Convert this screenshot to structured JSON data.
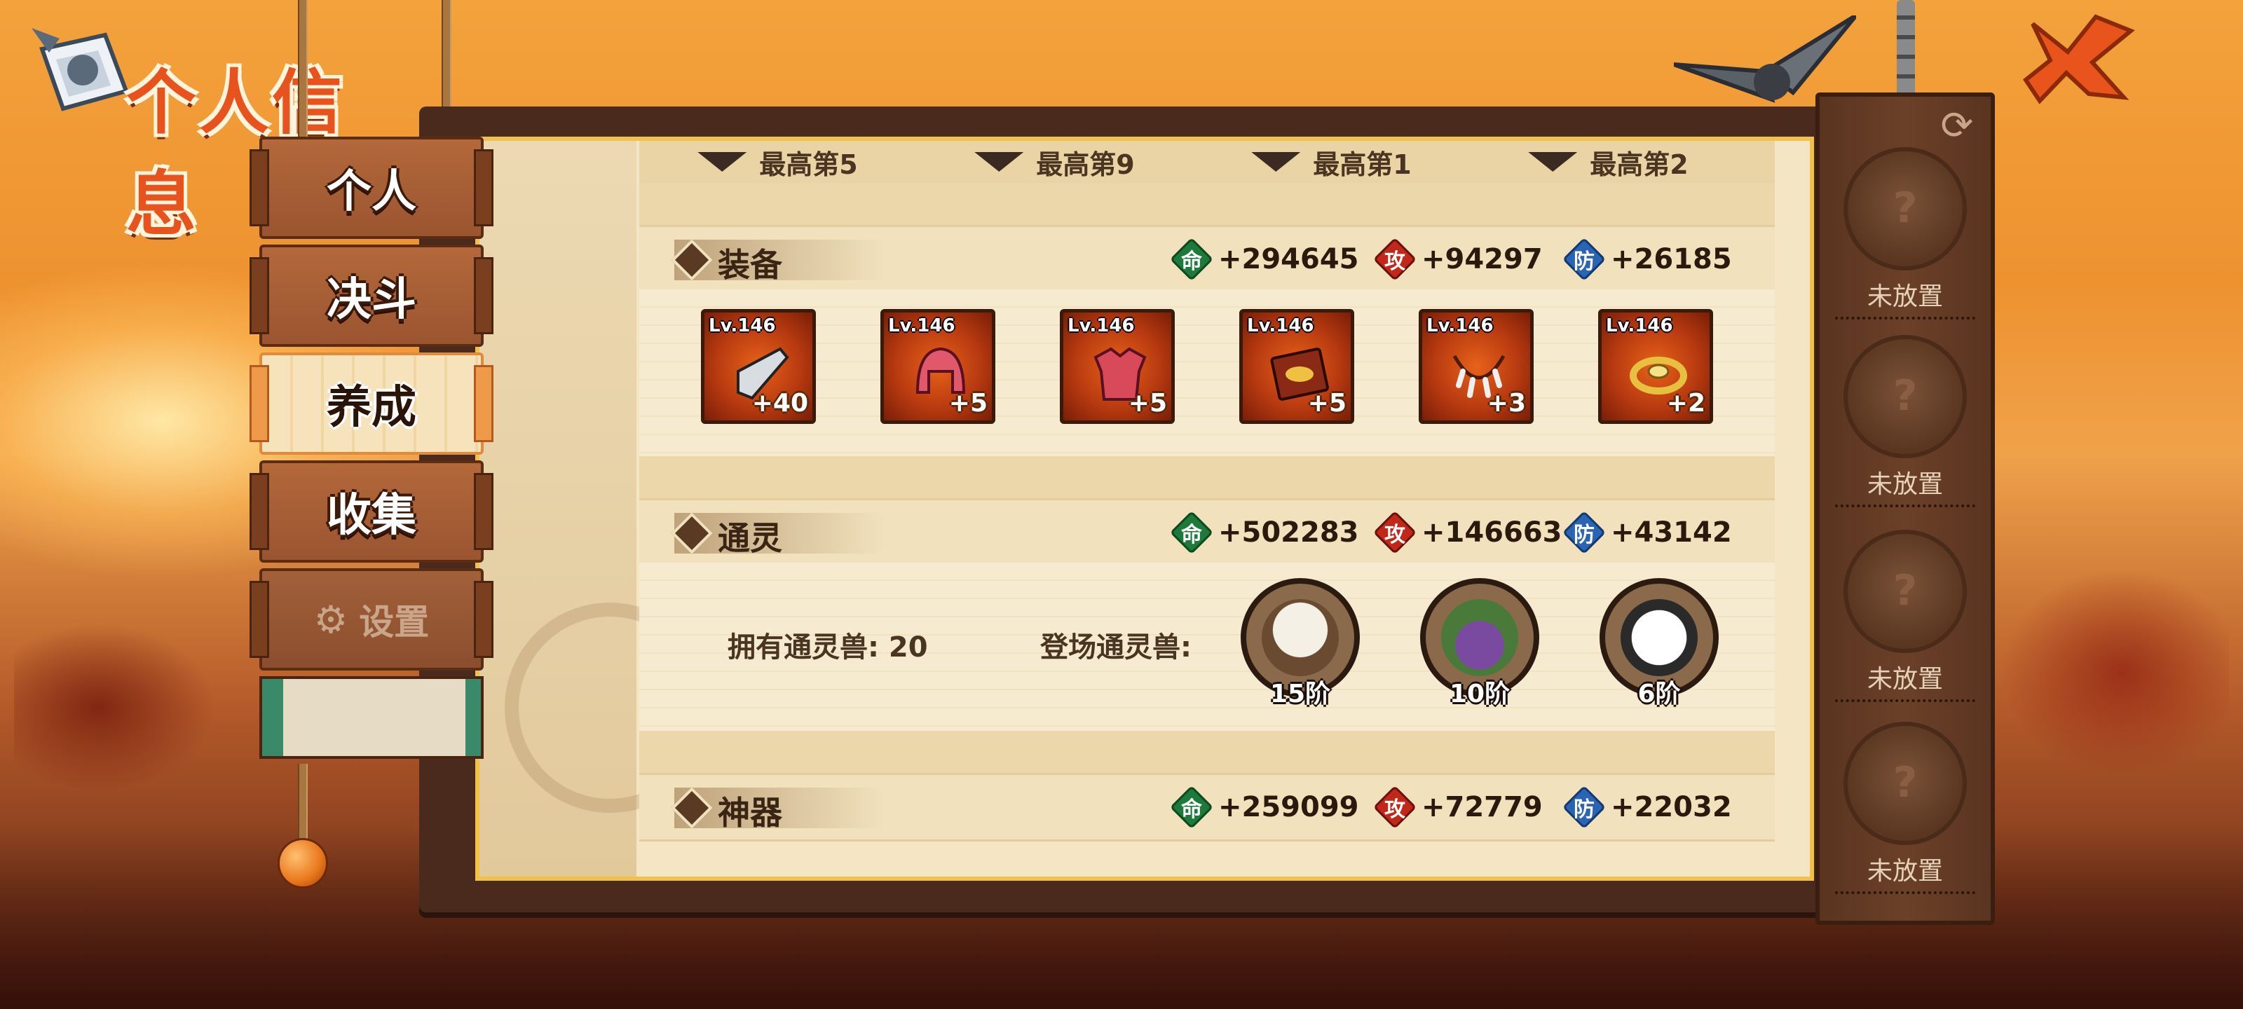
{
  "title": "个人信息",
  "menu": {
    "tabs": [
      {
        "label": "个人",
        "state": "normal"
      },
      {
        "label": "决斗",
        "state": "normal"
      },
      {
        "label": "养成",
        "state": "active"
      },
      {
        "label": "收集",
        "state": "normal"
      },
      {
        "label": "设置",
        "state": "disabled"
      }
    ]
  },
  "ranks": [
    {
      "label": "最高第5"
    },
    {
      "label": "最高第9"
    },
    {
      "label": "最高第1"
    },
    {
      "label": "最高第2"
    }
  ],
  "badges": {
    "hp": "命",
    "atk": "攻",
    "def": "防"
  },
  "sections": {
    "equipment": {
      "title": "装备",
      "hp": "+294645",
      "atk": "+94297",
      "def": "+26185",
      "items": [
        {
          "level": "Lv.146",
          "plus": "+40",
          "icon": "blade-icon"
        },
        {
          "level": "Lv.146",
          "plus": "+5",
          "icon": "helmet-icon"
        },
        {
          "level": "Lv.146",
          "plus": "+5",
          "icon": "armor-icon"
        },
        {
          "level": "Lv.146",
          "plus": "+5",
          "icon": "scroll-book-icon"
        },
        {
          "level": "Lv.146",
          "plus": "+3",
          "icon": "claw-necklace-icon"
        },
        {
          "level": "Lv.146",
          "plus": "+2",
          "icon": "headband-icon"
        }
      ]
    },
    "summon": {
      "title": "通灵",
      "hp": "+502283",
      "atk": "+146663",
      "def": "+43142",
      "owned_label": "拥有通灵兽: 20",
      "active_label": "登场通灵兽:",
      "beasts": [
        {
          "rank": "15阶",
          "icon": "monkey-summon-icon"
        },
        {
          "rank": "10阶",
          "icon": "toad-summon-icon"
        },
        {
          "rank": "6阶",
          "icon": "panda-summon-icon"
        }
      ]
    },
    "artifact": {
      "title": "神器",
      "hp": "+259099",
      "atk": "+72779",
      "def": "+22032"
    }
  },
  "slots": [
    {
      "label": "未放置"
    },
    {
      "label": "未放置"
    },
    {
      "label": "未放置"
    },
    {
      "label": "未放置"
    }
  ],
  "colors": {
    "accent": "#e8521c",
    "panel": "#f4e6c4",
    "frame_gold": "#f1c24a"
  }
}
